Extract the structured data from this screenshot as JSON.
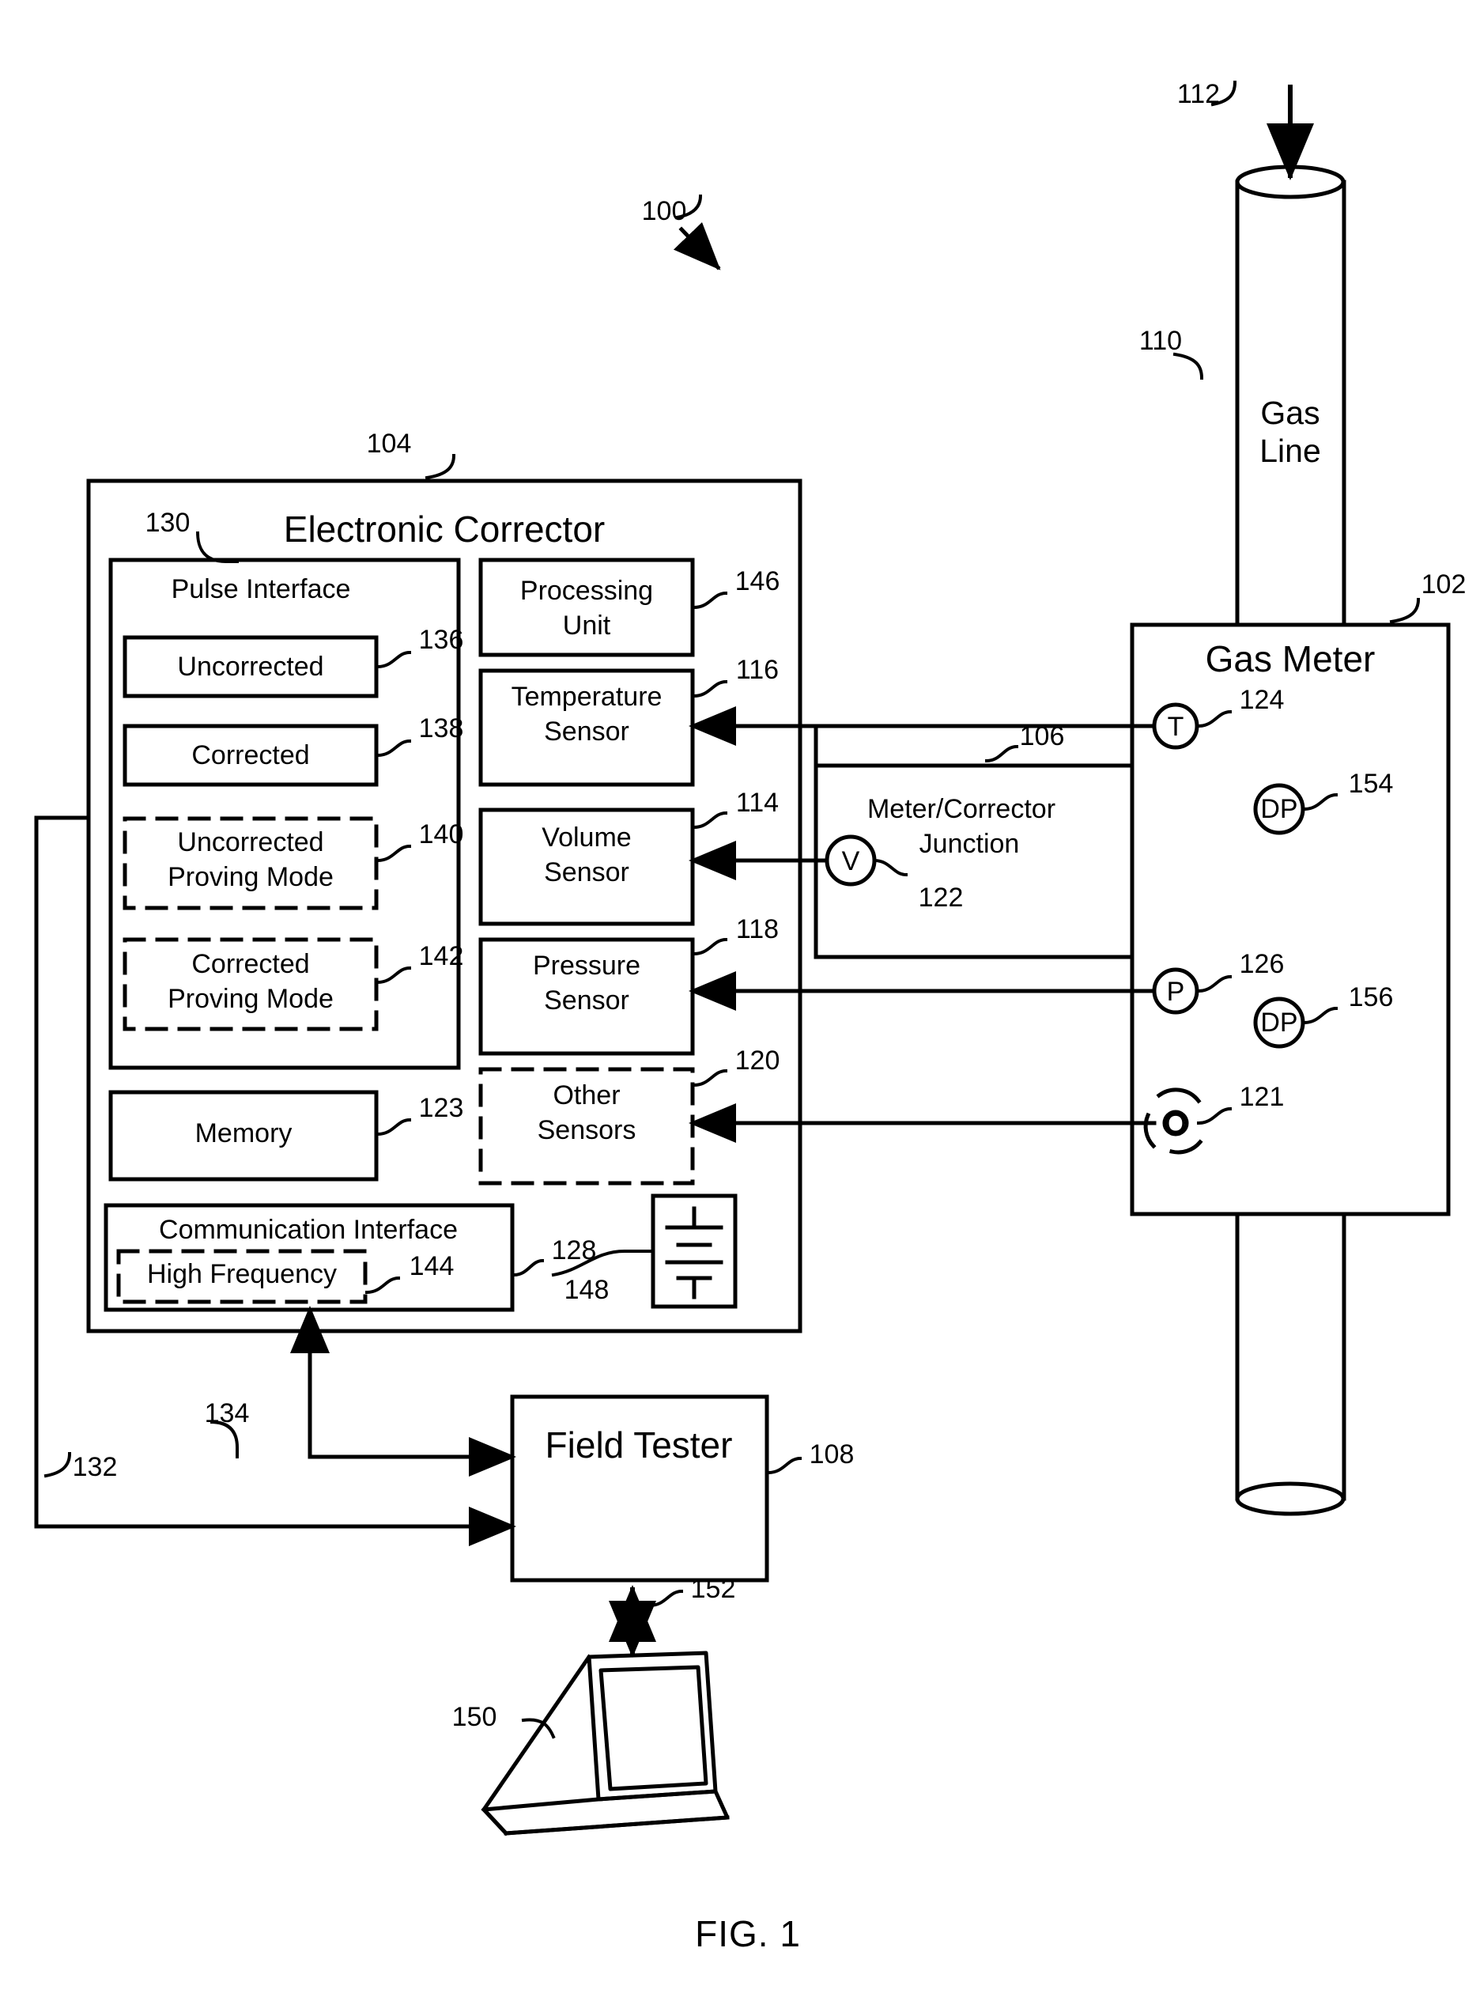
{
  "figure": {
    "caption": "FIG. 1",
    "system_ref": "100"
  },
  "gas_line": {
    "label": "Gas Line",
    "ref": "110",
    "flow_arrow_ref": "112"
  },
  "gas_meter": {
    "title": "Gas Meter",
    "ref": "102",
    "sensors": [
      {
        "symbol": "T",
        "ref": "124",
        "name": "temperature-sensor-node"
      },
      {
        "symbol": "DP",
        "ref": "154",
        "name": "differential-pressure-node-upper"
      },
      {
        "symbol": "P",
        "ref": "126",
        "name": "pressure-sensor-node"
      },
      {
        "symbol": "DP",
        "ref": "156",
        "name": "differential-pressure-node-lower"
      },
      {
        "symbol": "O",
        "ref": "121",
        "name": "other-sensor-node"
      }
    ]
  },
  "junction": {
    "label": "Meter/Corrector\nJunction",
    "label_line1": "Meter/Corrector",
    "label_line2": "Junction",
    "ref": "122",
    "bus_ref": "106",
    "volume_symbol": "V"
  },
  "corrector": {
    "title": "Electronic Corrector",
    "ref": "104",
    "pulse_interface": {
      "title": "Pulse Interface",
      "ref": "130",
      "items": [
        {
          "label": "Uncorrected",
          "ref": "136",
          "dashed": false
        },
        {
          "label": "Corrected",
          "ref": "138",
          "dashed": false
        },
        {
          "label": "Uncorrected\nProving Mode",
          "line1": "Uncorrected",
          "line2": "Proving Mode",
          "ref": "140",
          "dashed": true
        },
        {
          "label": "Corrected\nProving Mode",
          "line1": "Corrected",
          "line2": "Proving Mode",
          "ref": "142",
          "dashed": true
        }
      ]
    },
    "memory": {
      "label": "Memory",
      "ref": "123"
    },
    "communication_interface": {
      "label": "Communication Interface",
      "ref": "128",
      "sub": {
        "label": "High Frequency",
        "ref": "144",
        "dashed": true
      }
    },
    "battery": {
      "ref": "148",
      "symbol": "battery"
    },
    "modules": [
      {
        "line1": "Processing",
        "line2": "Unit",
        "ref": "146",
        "dashed": false
      },
      {
        "line1": "Temperature",
        "line2": "Sensor",
        "ref": "116",
        "dashed": false
      },
      {
        "line1": "Volume",
        "line2": "Sensor",
        "ref": "114",
        "dashed": false
      },
      {
        "line1": "Pressure",
        "line2": "Sensor",
        "ref": "118",
        "dashed": false
      },
      {
        "line1": "Other",
        "line2": "Sensors",
        "ref": "120",
        "dashed": true
      }
    ]
  },
  "field_tester": {
    "label": "Field Tester",
    "ref": "108"
  },
  "laptop": {
    "ref": "150",
    "link_ref": "152"
  },
  "signals": {
    "pulse_out_ref": "132",
    "comm_ref": "134"
  }
}
